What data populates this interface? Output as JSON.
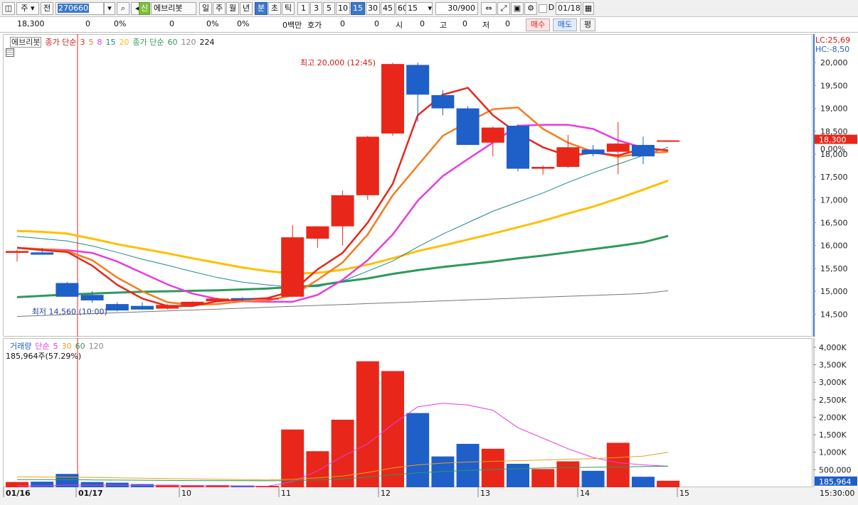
{
  "toolbar": {
    "market_label": "주",
    "period_label": "전",
    "code_value": "270660",
    "new_badge": "신",
    "stock_name": "에브리봇",
    "tf_day": "일",
    "tf_week": "주",
    "tf_month": "월",
    "tf_year": "년",
    "tf_min": "분",
    "tf_sec": "초",
    "tf_tick": "틱",
    "intervals": [
      "1",
      "3",
      "5",
      "10",
      "15",
      "30",
      "45",
      "60"
    ],
    "selected_interval": "15",
    "interval_value": "15",
    "count_value": "30/900",
    "date_value": "01/18",
    "d_label": "D"
  },
  "quote_bar": {
    "price": "18,300",
    "v1": "0",
    "p1": "0%",
    "v2": "0",
    "p2": "0%",
    "p3": "0%",
    "unit": "0백만",
    "hoga_label": "호가",
    "hoga1": "0",
    "hoga2": "0",
    "si_label": "시",
    "si_val": "0",
    "go_label": "고",
    "go_val": "0",
    "jeo_label": "저",
    "jeo_val": "0",
    "buy_label": "매수",
    "sell_label": "매도",
    "eval_label": "평"
  },
  "price_pane": {
    "legend_name": "에브리봇",
    "legend_ma_label": "종가 단순",
    "legend_ma_periods": [
      "3",
      "5",
      "8",
      "15",
      "20"
    ],
    "legend_ma2_label": "종가 단순",
    "legend_ma2_periods": [
      "60",
      "120",
      "224"
    ],
    "lc_label": "LC:25,69",
    "hc_label": "HC:-8,50",
    "high_annotation": "최고 20,000 (12:45)",
    "low_annotation": "최저 14,560 (10:00)",
    "current_price_label": "18,300",
    "current_pct_label": "0.00%",
    "y_ticks": [
      "20,000",
      "19,500",
      "19,000",
      "18,500",
      "18,000",
      "17,500",
      "17,000",
      "16,500",
      "16,000",
      "15,500",
      "15,000",
      "14,500"
    ]
  },
  "volume_pane": {
    "legend_name": "거래량",
    "legend_ma_label": "단순",
    "legend_ma_periods": [
      "5",
      "30",
      "60",
      "120"
    ],
    "volume_text": "185,964주(57.29%)",
    "current_vol_label": "185,964",
    "current_pct_label": "57.29%",
    "y_ticks": [
      "4,000K",
      "3,500K",
      "3,000K",
      "2,500K",
      "2,000K",
      "1,500K",
      "1,000K",
      "500,000"
    ]
  },
  "x_axis": {
    "labels": [
      "01/16",
      "01/17",
      "10",
      "11",
      "12",
      "13",
      "14",
      "15"
    ],
    "time_label": "15:30:00"
  },
  "colors": {
    "up": "#e8271a",
    "down": "#1f5fc8",
    "ma3": "#e8271a",
    "ma5": "#f57c1f",
    "ma8": "#e83ce0",
    "ma15": "#1a8a8a",
    "ma20": "#ffc000",
    "ma60": "#2e9a5a",
    "ma120": "#777777"
  },
  "chart_data": {
    "type": "candlestick",
    "ylim": [
      14100,
      20500
    ],
    "candles": [
      {
        "o": 15840,
        "h": 15900,
        "l": 15650,
        "c": 15880,
        "v": 150
      },
      {
        "o": 15850,
        "h": 15950,
        "l": 15800,
        "c": 15800,
        "v": 160
      },
      {
        "o": 15180,
        "h": 15200,
        "l": 14880,
        "c": 14880,
        "v": 380
      },
      {
        "o": 14920,
        "h": 15000,
        "l": 14750,
        "c": 14800,
        "v": 150
      },
      {
        "o": 14720,
        "h": 14760,
        "l": 14560,
        "c": 14580,
        "v": 130
      },
      {
        "o": 14680,
        "h": 14760,
        "l": 14600,
        "c": 14600,
        "v": 90
      },
      {
        "o": 14620,
        "h": 14720,
        "l": 14600,
        "c": 14700,
        "v": 70
      },
      {
        "o": 14700,
        "h": 14780,
        "l": 14680,
        "c": 14770,
        "v": 60
      },
      {
        "o": 14780,
        "h": 14860,
        "l": 14760,
        "c": 14840,
        "v": 60
      },
      {
        "o": 14850,
        "h": 14870,
        "l": 14780,
        "c": 14830,
        "v": 50
      },
      {
        "o": 14820,
        "h": 14860,
        "l": 14800,
        "c": 14850,
        "v": 40
      },
      {
        "o": 14880,
        "h": 16450,
        "l": 14870,
        "c": 16180,
        "v": 1650
      },
      {
        "o": 16150,
        "h": 16400,
        "l": 15950,
        "c": 16420,
        "v": 1030
      },
      {
        "o": 16420,
        "h": 17200,
        "l": 16000,
        "c": 17100,
        "v": 1930
      },
      {
        "o": 17100,
        "h": 18400,
        "l": 17000,
        "c": 18380,
        "v": 3600
      },
      {
        "o": 18450,
        "h": 20000,
        "l": 18400,
        "c": 19970,
        "v": 3320
      },
      {
        "o": 19950,
        "h": 20000,
        "l": 18700,
        "c": 19300,
        "v": 2120
      },
      {
        "o": 19290,
        "h": 19400,
        "l": 18850,
        "c": 19000,
        "v": 880
      },
      {
        "o": 19000,
        "h": 19050,
        "l": 18200,
        "c": 18200,
        "v": 1240
      },
      {
        "o": 18250,
        "h": 18600,
        "l": 17950,
        "c": 18580,
        "v": 1100
      },
      {
        "o": 18620,
        "h": 18650,
        "l": 17620,
        "c": 17680,
        "v": 670
      },
      {
        "o": 17680,
        "h": 17750,
        "l": 17550,
        "c": 17720,
        "v": 520
      },
      {
        "o": 17720,
        "h": 18420,
        "l": 17700,
        "c": 18150,
        "v": 740
      },
      {
        "o": 18100,
        "h": 18200,
        "l": 17950,
        "c": 18000,
        "v": 470
      },
      {
        "o": 18050,
        "h": 18700,
        "l": 17560,
        "c": 18230,
        "v": 1270
      },
      {
        "o": 18200,
        "h": 18380,
        "l": 17780,
        "c": 17950,
        "v": 300
      },
      {
        "o": 18300,
        "h": 18300,
        "l": 18300,
        "c": 18300,
        "v": 186
      }
    ],
    "ma_series": [
      {
        "period": 3,
        "values": [
          15950,
          15900,
          15860,
          15560,
          15140,
          14840,
          14680,
          14680,
          14780,
          14820,
          14850,
          15000,
          15480,
          15840,
          16500,
          17350,
          18850,
          19300,
          19450,
          18850,
          18450,
          18150,
          17960,
          18030,
          17970,
          18120,
          18080
        ]
      },
      {
        "period": 5,
        "values": [
          15950,
          15920,
          15880,
          15680,
          15300,
          15000,
          14760,
          14700,
          14720,
          14780,
          14800,
          14910,
          15250,
          15630,
          16240,
          17100,
          17750,
          18400,
          18700,
          18980,
          19020,
          18550,
          18250,
          18050,
          17940,
          18020,
          18050
        ]
      },
      {
        "period": 8,
        "values": [
          15950,
          15920,
          15900,
          15840,
          15650,
          15400,
          15150,
          14950,
          14830,
          14780,
          14770,
          14770,
          14920,
          15250,
          15680,
          16240,
          16980,
          17520,
          17890,
          18250,
          18620,
          18640,
          18640,
          18550,
          18300,
          18140,
          18080
        ]
      },
      {
        "period": 15,
        "values": [
          16200,
          16150,
          16100,
          15990,
          15850,
          15700,
          15570,
          15430,
          15300,
          15200,
          15140,
          15090,
          15100,
          15220,
          15440,
          15660,
          15970,
          16250,
          16500,
          16750,
          16950,
          17150,
          17380,
          17590,
          17780,
          17970,
          18150
        ]
      },
      {
        "period": 20,
        "values": [
          16320,
          16300,
          16260,
          16150,
          16030,
          15930,
          15830,
          15720,
          15620,
          15520,
          15440,
          15390,
          15400,
          15470,
          15580,
          15720,
          15880,
          16000,
          16130,
          16260,
          16400,
          16540,
          16700,
          16850,
          17030,
          17220,
          17420
        ]
      },
      {
        "period": 60,
        "values": [
          14870,
          14900,
          14930,
          14950,
          14970,
          14990,
          15000,
          15010,
          15020,
          15040,
          15060,
          15090,
          15130,
          15210,
          15280,
          15380,
          15460,
          15530,
          15590,
          15650,
          15720,
          15780,
          15850,
          15920,
          15990,
          16070,
          16210
        ]
      },
      {
        "period": 120,
        "values": [
          14450,
          14470,
          14490,
          14510,
          14530,
          14550,
          14570,
          14590,
          14610,
          14630,
          14650,
          14670,
          14690,
          14710,
          14730,
          14750,
          14770,
          14790,
          14810,
          14830,
          14850,
          14870,
          14890,
          14910,
          14930,
          14950,
          15010
        ]
      }
    ],
    "volume_unit": "K",
    "volume_ylim": [
      0,
      4100
    ],
    "volume_ma": [
      {
        "period": 5,
        "values": [
          40,
          40,
          60,
          60,
          60,
          50,
          45,
          40,
          40,
          35,
          30,
          160,
          470,
          880,
          1240,
          1800,
          2300,
          2400,
          2350,
          2200,
          1700,
          1400,
          1100,
          850,
          700,
          640,
          600
        ]
      },
      {
        "period": 30,
        "values": [
          300,
          290,
          290,
          280,
          270,
          260,
          250,
          240,
          230,
          220,
          210,
          230,
          270,
          320,
          420,
          550,
          640,
          690,
          720,
          740,
          760,
          780,
          800,
          820,
          850,
          890,
          1000
        ]
      },
      {
        "period": 60,
        "values": [
          220,
          215,
          215,
          210,
          205,
          200,
          195,
          190,
          188,
          186,
          184,
          190,
          210,
          240,
          290,
          360,
          410,
          450,
          480,
          510,
          530,
          550,
          560,
          570,
          580,
          590,
          600
        ]
      }
    ]
  }
}
